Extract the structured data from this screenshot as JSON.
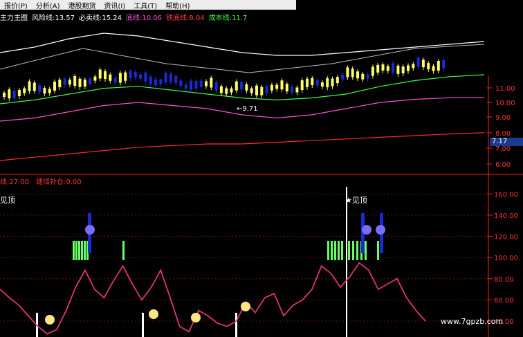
{
  "menu": [
    "报价(P)",
    "分析(A)",
    "港股期货",
    "资讯(I)",
    "工具(T)",
    "帮助(H)"
  ],
  "indicator_header": {
    "title": "主力主图",
    "items": [
      {
        "label": "风险线:",
        "value": "13.57",
        "color": "#ffffff"
      },
      {
        "label": "必卖线:",
        "value": "15.24",
        "color": "#ffffff"
      },
      {
        "label": "底线:",
        "value": "10.06",
        "color": "#ff4fd8"
      },
      {
        "label": "铁底线:",
        "value": "8.04",
        "color": "#ff4040"
      },
      {
        "label": "成本线:",
        "value": "11.7",
        "color": "#40ff40"
      }
    ]
  },
  "lower_header": {
    "items": [
      {
        "label": "线:",
        "value": "27.00",
        "color": "#ff3333"
      },
      {
        "label": "建增补仓:",
        "value": "0.00",
        "color": "#ff3333"
      }
    ]
  },
  "annotations": {
    "low_price": "←9.71",
    "top_signal_left": "见顶",
    "top_signal_right": "★见顶"
  },
  "price_tag": "7.17",
  "watermark": "www.7gpzb.com",
  "colors": {
    "background": "#000000",
    "axis": "#ff2020",
    "up_candle": "#ffff66",
    "down_candle": "#1a2bd6",
    "risk_line": "#ffffff",
    "bottom_line": "#ff4fd8",
    "iron_bottom_line": "#ff2a2a",
    "cost_line": "#40ff40",
    "oscillator": "#e0347a",
    "top_bar": "#66ff66",
    "down_bar": "#1a2bd6"
  },
  "chart_data": [
    {
      "type": "line",
      "panel": "price",
      "y_ticks": [
        "11.00",
        "10.00",
        "9.00",
        "8.00",
        "7.00",
        "6.00"
      ],
      "ylim": [
        5.5,
        11.5
      ],
      "series": [
        {
          "name": "风险线",
          "values": [
            13.6,
            13.8,
            14.1,
            14.3,
            14.2,
            14.0,
            13.8,
            13.6,
            13.5,
            13.5,
            13.6,
            13.7,
            13.8,
            13.9,
            14.0
          ]
        },
        {
          "name": "底线",
          "values": [
            9.3,
            9.4,
            9.6,
            9.8,
            9.9,
            9.8,
            9.7,
            9.5,
            9.4,
            9.5,
            9.7,
            9.9,
            10.0,
            10.05,
            10.06
          ]
        },
        {
          "name": "铁底线",
          "values": [
            7.2,
            7.3,
            7.4,
            7.5,
            7.6,
            7.65,
            7.7,
            7.7,
            7.75,
            7.8,
            7.85,
            7.9,
            7.95,
            8.0,
            8.04
          ]
        },
        {
          "name": "成本线",
          "values": [
            9.9,
            10.1,
            10.4,
            10.7,
            10.8,
            10.6,
            10.4,
            10.2,
            10.1,
            10.2,
            10.4,
            10.8,
            11.1,
            11.3,
            11.4
          ]
        }
      ]
    },
    {
      "type": "line",
      "panel": "oscillator",
      "y_ticks": [
        "160.00",
        "140.00",
        "120.00",
        "100.00",
        "80.00",
        "60.00",
        "40.00"
      ],
      "ylim": [
        25,
        168
      ],
      "series": [
        {
          "name": "",
          "values": [
            70,
            62,
            55,
            45,
            35,
            28,
            32,
            50,
            72,
            88,
            70,
            62,
            78,
            92,
            75,
            60,
            72,
            88,
            62,
            35,
            30,
            50,
            45,
            38,
            35,
            40,
            58,
            48,
            62,
            66,
            45,
            55,
            60,
            70,
            92,
            85,
            72,
            82,
            95,
            88,
            70,
            75,
            80,
            62,
            50,
            40
          ]
        }
      ]
    }
  ]
}
